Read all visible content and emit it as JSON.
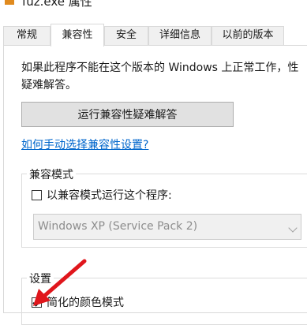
{
  "window": {
    "title": "fuz.exe 属性"
  },
  "tabs": [
    {
      "label": "常规",
      "active": false
    },
    {
      "label": "兼容性",
      "active": true
    },
    {
      "label": "安全",
      "active": false
    },
    {
      "label": "详细信息",
      "active": false
    },
    {
      "label": "以前的版本",
      "active": false
    }
  ],
  "compat_page": {
    "intro_text": "如果此程序不能在这个版本的 Windows 上正常工作，性疑难解答。",
    "troubleshoot_button": "运行兼容性疑难解答",
    "help_link": "如何手动选择兼容性设置?",
    "compat_mode_group": {
      "legend": "兼容模式",
      "checkbox_label": "以兼容模式运行这个程序:",
      "checked": false,
      "os_select_value": "Windows XP (Service Pack 2)",
      "os_select_enabled": false
    },
    "settings_group": {
      "legend": "设置",
      "reduced_color_label": "简化的颜色模式",
      "reduced_color_checked": true
    }
  },
  "colors": {
    "link": "#0066cc",
    "annotation_arrow": "#e0161c",
    "disabled_text": "#8d8d8d"
  }
}
